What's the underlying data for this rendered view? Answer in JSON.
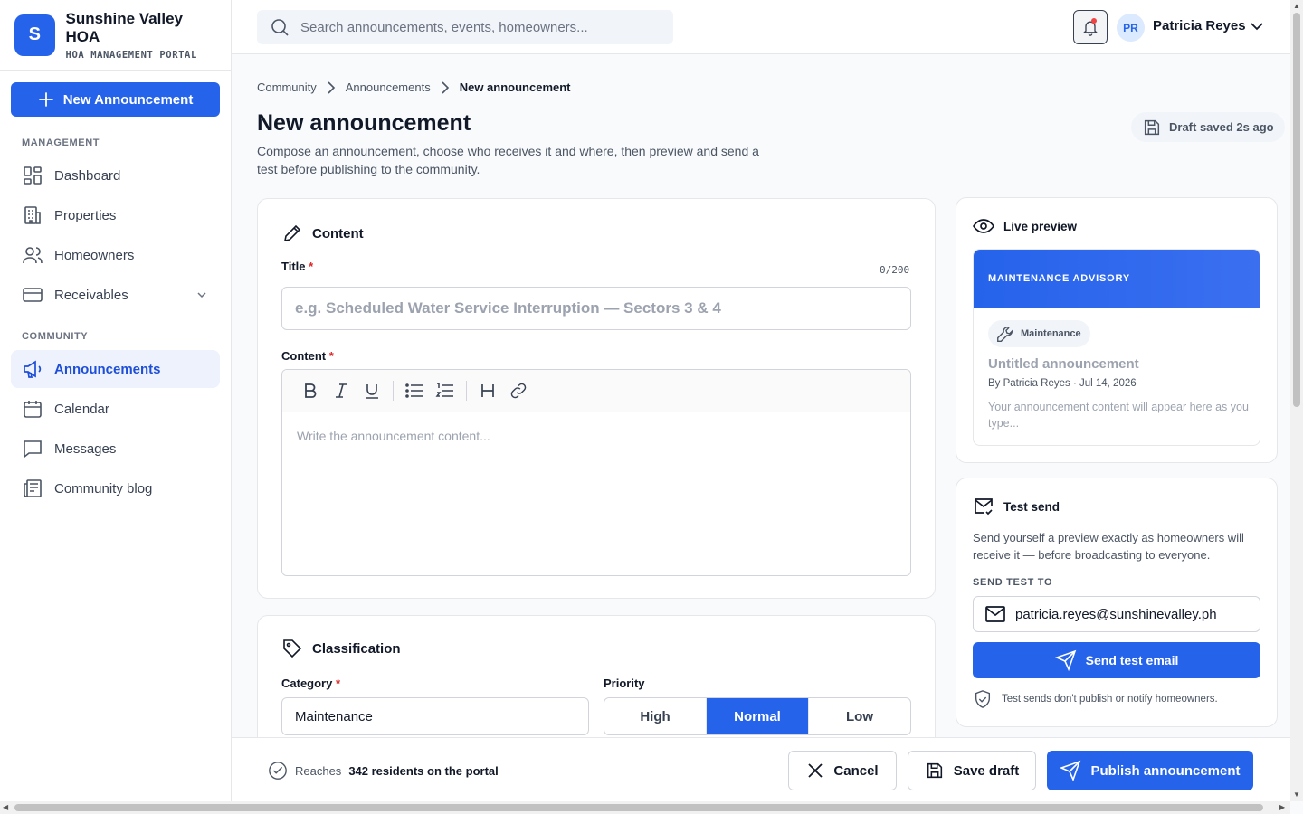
{
  "app": {
    "logo_letter": "S",
    "name": "Sunshine Valley HOA",
    "subtitle": "HOA MANAGEMENT PORTAL"
  },
  "sidebar": {
    "new_button": "New Announcement",
    "sections": [
      {
        "label": "MANAGEMENT"
      },
      {
        "label": "COMMUNITY"
      }
    ],
    "items": [
      {
        "label": "Dashboard",
        "icon": "grid-icon"
      },
      {
        "label": "Properties",
        "icon": "building-icon"
      },
      {
        "label": "Homeowners",
        "icon": "users-icon"
      },
      {
        "label": "Receivables",
        "icon": "credit-card-icon"
      },
      {
        "label": "Announcements",
        "icon": "megaphone-icon",
        "active": true
      },
      {
        "label": "Calendar",
        "icon": "calendar-icon"
      },
      {
        "label": "Messages",
        "icon": "message-icon"
      },
      {
        "label": "Community blog",
        "icon": "newspaper-icon"
      }
    ]
  },
  "topbar": {
    "search_placeholder": "Search announcements, events, homeowners...",
    "user_initials": "PR",
    "user_name": "Patricia Reyes"
  },
  "breadcrumb": [
    "Community",
    "Announcements",
    "New announcement"
  ],
  "page": {
    "title": "New announcement",
    "description": "Compose an announcement, choose who receives it and where, then preview and send a test before publishing to the community.",
    "draft_status": "Draft saved 2s ago"
  },
  "content_card": {
    "heading": "Content",
    "title_label": "Title",
    "required_mark": "*",
    "title_counter": "0/200",
    "title_value": "",
    "title_placeholder": "e.g. Scheduled Water Service Interruption — Sectors 3 & 4",
    "content_label": "Content",
    "content_placeholder": "Write the announcement content..."
  },
  "classification_card": {
    "heading": "Classification",
    "category_label": "Category",
    "category_value": "Maintenance",
    "priority_label": "Priority",
    "priority_options": [
      "High",
      "Normal",
      "Low"
    ],
    "priority_selected": "Normal"
  },
  "preview": {
    "heading": "Live preview",
    "banner": "MAINTENANCE ADVISORY",
    "chip": "Maintenance",
    "title": "Untitled announcement",
    "meta": "By Patricia Reyes · Jul 14, 2026",
    "body": "Your announcement content will appear here as you type..."
  },
  "test_send": {
    "heading": "Test send",
    "description": "Send yourself a preview exactly as homeowners will receive it — before broadcasting to everyone.",
    "to_label": "SEND TEST TO",
    "email": "patricia.reyes@sunshinevalley.ph",
    "button": "Send test email",
    "note": "Test sends don't publish or notify homeowners."
  },
  "footer": {
    "reach_prefix": "Reaches",
    "reach_value": "342 residents on the portal",
    "cancel": "Cancel",
    "save_draft": "Save draft",
    "publish": "Publish announcement"
  },
  "colors": {
    "accent": "#2563eb",
    "required": "#dc2626",
    "notification_dot": "#ef4444"
  }
}
